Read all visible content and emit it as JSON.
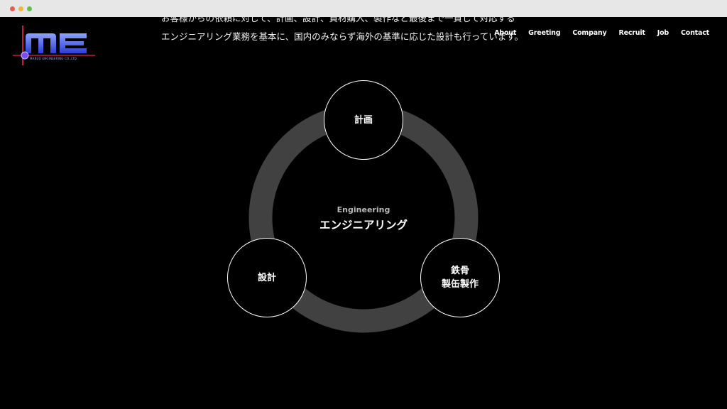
{
  "browser": {
    "window_controls": [
      "close",
      "minimize",
      "maximize"
    ]
  },
  "logo": {
    "letters": "ME",
    "company_text": "MARUO ENGINEERING CO.,LTD"
  },
  "intro": {
    "line1": "お客様からの依頼に対して、計画、設計、資材購入、製作など最後まで一貫して対応する",
    "line2": "エンジニアリング業務を基本に、国内のみならず海外の基準に応じた設計も行っています。"
  },
  "nav": {
    "items": [
      {
        "label": "About"
      },
      {
        "label": "Greeting"
      },
      {
        "label": "Company"
      },
      {
        "label": "Recruit"
      },
      {
        "label": "Job"
      },
      {
        "label": "Contact"
      }
    ]
  },
  "diagram": {
    "center_en": "Engineering",
    "center_jp": "エンジニアリング",
    "nodes": {
      "top": "計画",
      "left": "設計",
      "right_line1": "鉄骨",
      "right_line2": "製缶製作"
    }
  },
  "colors": {
    "background": "#000000",
    "ring": "#414141",
    "text": "#ffffff",
    "logo_blue": "#3d5cff",
    "logo_red": "#d2283c"
  }
}
